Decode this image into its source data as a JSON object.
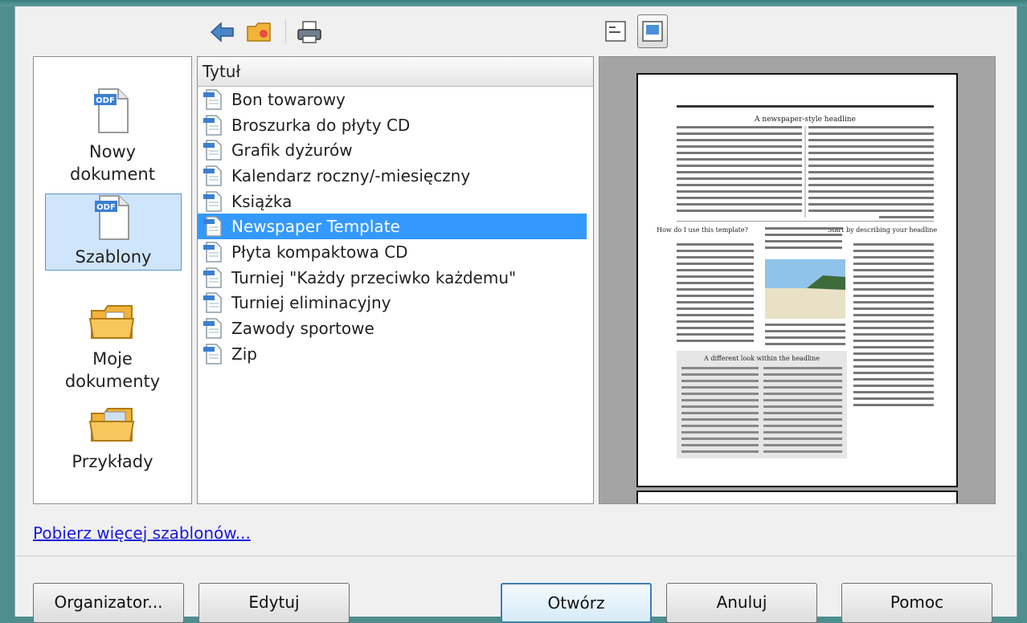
{
  "toolbar": {
    "back_icon": "back-arrow-icon",
    "folder_icon": "folder-up-icon",
    "print_icon": "printer-icon",
    "view_list_icon": "list-view-icon",
    "view_preview_icon": "preview-view-icon"
  },
  "categories": [
    {
      "label": "Nowy dokument",
      "icon": "new-document-icon"
    },
    {
      "label": "Szablony",
      "icon": "templates-icon",
      "selected": true
    },
    {
      "label": "Moje dokumenty",
      "icon": "my-documents-folder-icon"
    },
    {
      "label": "Przykłady",
      "icon": "examples-folder-icon"
    }
  ],
  "list": {
    "header": "Tytuł",
    "items": [
      "Bon towarowy",
      "Broszurka do płyty CD",
      "Grafik dyżurów",
      "Kalendarz roczny/-miesięczny",
      "Książka",
      "Newspaper Template",
      "Płyta kompaktowa CD",
      "Turniej \"Każdy przeciwko każdemu\"",
      "Turniej eliminacyjny",
      "Zawody sportowe",
      "Zip"
    ],
    "selected_index": 5
  },
  "preview": {
    "headline": "A newspaper-style headline",
    "subhead_left": "How do I use this template?",
    "subhead_right": "Start by describing your headline",
    "subhead_bottom": "A different look within the headline"
  },
  "links": {
    "more_templates": "Pobierz więcej szablonów..."
  },
  "buttons": {
    "organizer": "Organizator...",
    "edit": "Edytuj",
    "open": "Otwórz",
    "cancel": "Anuluj",
    "help": "Pomoc"
  },
  "colors": {
    "selection": "#3399ff",
    "category_selected": "#cfe5fb",
    "link": "#1a1adb"
  }
}
